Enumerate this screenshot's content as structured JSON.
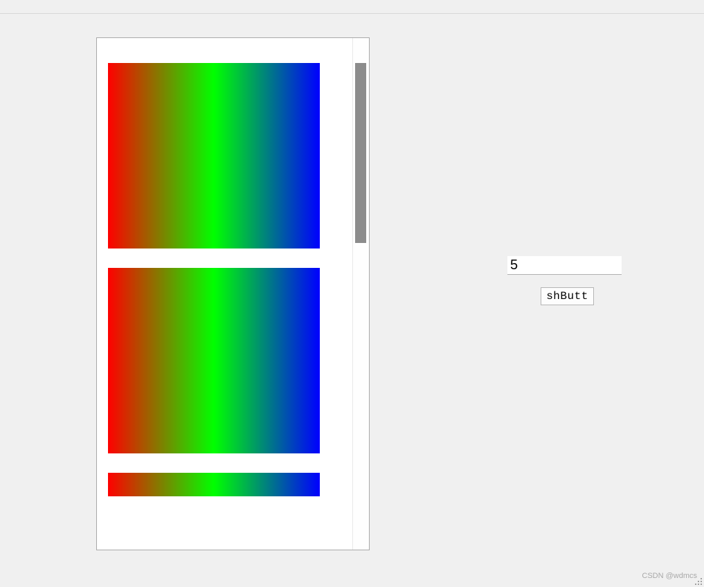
{
  "window": {
    "title": ""
  },
  "listPanel": {
    "itemCount": 3,
    "gradient": {
      "start": "#ff0000",
      "mid": "#00ff00",
      "end": "#0000ff"
    }
  },
  "controls": {
    "inputValue": "5",
    "buttonLabel": "shButt"
  },
  "watermark": "CSDN @wdmcs"
}
